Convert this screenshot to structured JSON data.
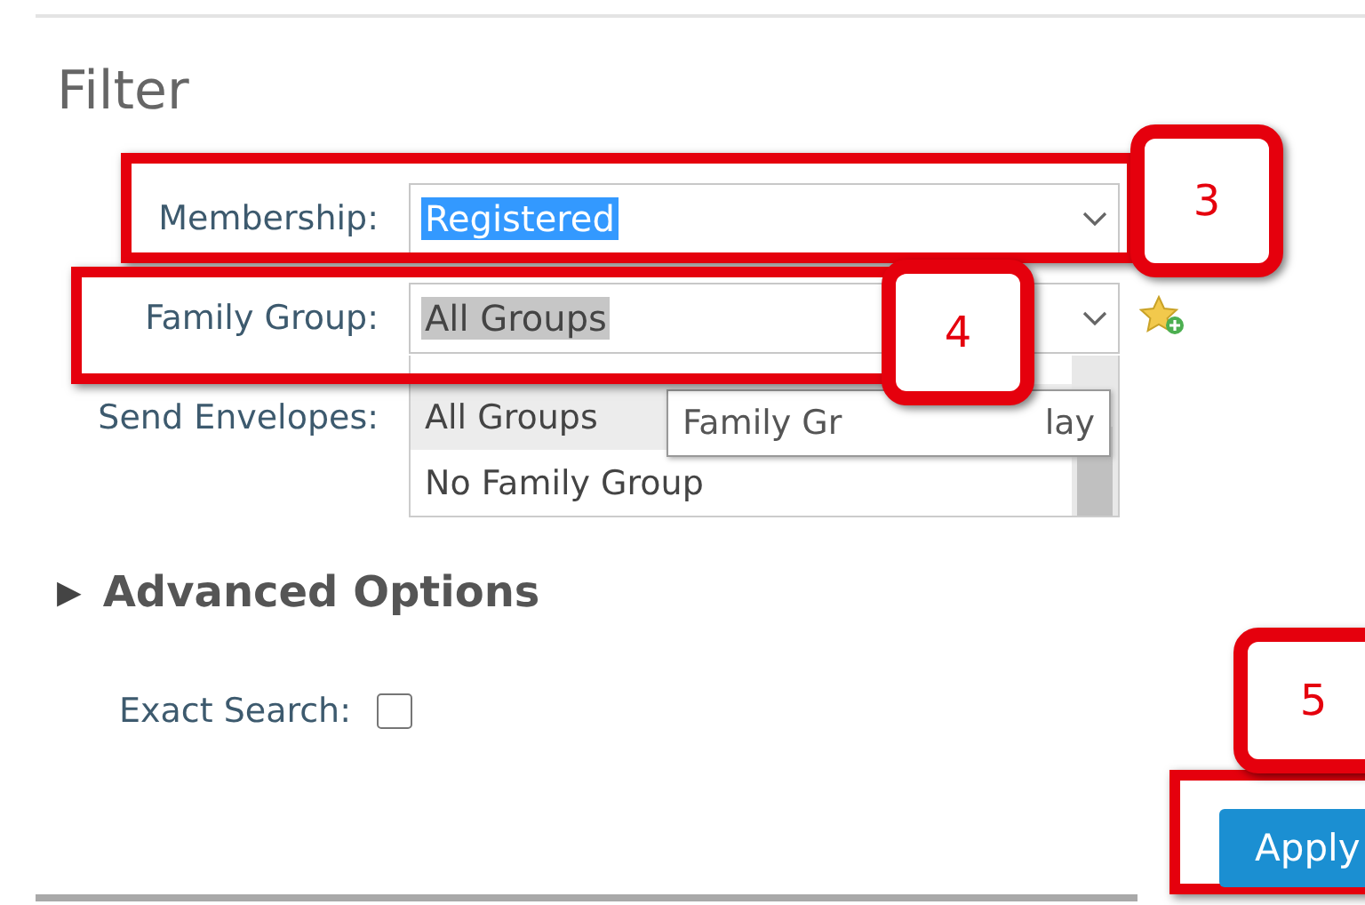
{
  "heading": "Filter",
  "fields": [
    {
      "label": "Membership:",
      "kind": "select",
      "value": "Registered",
      "focused": true
    },
    {
      "label": "Family Group:",
      "kind": "select",
      "value": "All Groups",
      "focused": false
    },
    {
      "label": "Send Envelopes:",
      "kind": "hidden"
    }
  ],
  "dropdown": {
    "options": [
      {
        "label": "All Groups",
        "selected": true
      },
      {
        "label": "No Family Group",
        "selected": false
      }
    ]
  },
  "tooltip": {
    "parts": [
      "Family Gr",
      "lay"
    ]
  },
  "advanced": {
    "arrow": "▶",
    "label": "Advanced Options",
    "expanded": false
  },
  "exact_search": {
    "label": "Exact Search:",
    "checked": false
  },
  "apply_button": "Apply",
  "callouts": [
    {
      "number": "3"
    },
    {
      "number": "4"
    },
    {
      "number": "5"
    }
  ]
}
